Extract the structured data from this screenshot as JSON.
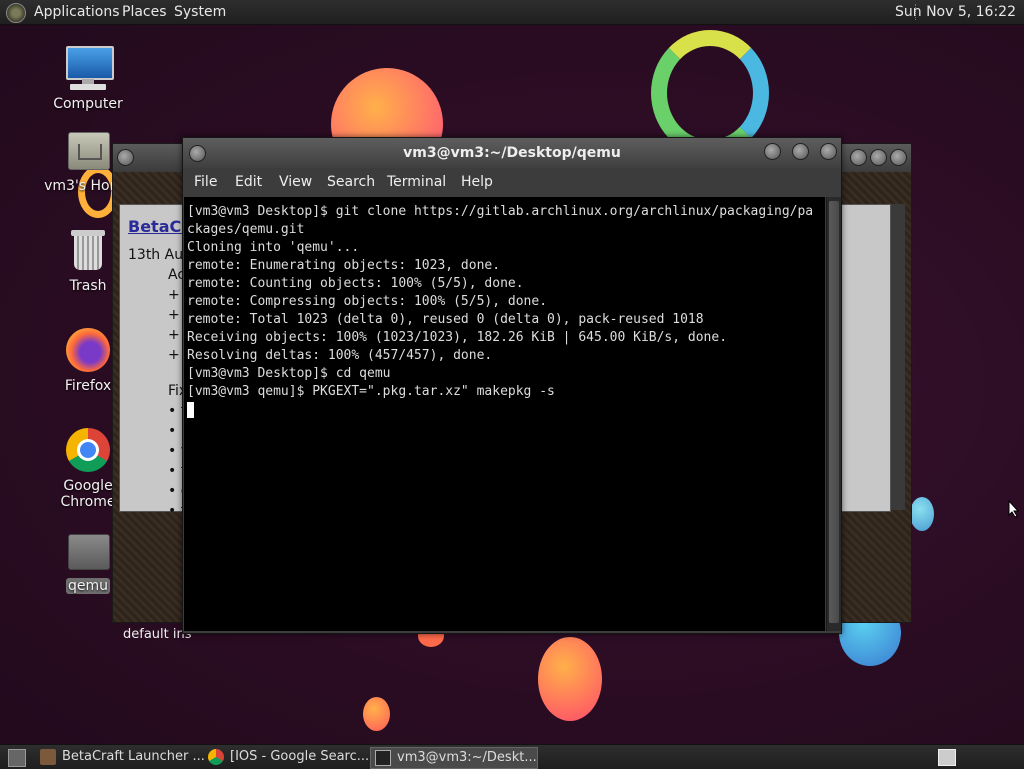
{
  "top_panel": {
    "menus": [
      "Applications",
      "Places",
      "System"
    ],
    "clock": "Sun Nov 5, 16:22"
  },
  "desktop_icons": [
    {
      "label": "Computer",
      "icon": "computer-icon"
    },
    {
      "label": "vm3's Home",
      "icon": "home-folder-icon"
    },
    {
      "label": "Trash",
      "icon": "trash-icon"
    },
    {
      "label": "Firefox",
      "icon": "firefox-icon"
    },
    {
      "label": "Google Chrome",
      "icon": "chrome-icon"
    },
    {
      "label": "qemu",
      "icon": "folder-icon",
      "selected": true
    }
  ],
  "background_window": {
    "link": "BetaCraft",
    "date": "13th Aug",
    "lines": [
      "Ac",
      "+ (",
      "+ (",
      "+ l",
      "+ l",
      "Fix",
      "• fi",
      "• D",
      "• v",
      "• th",
      "• c",
      "• fi"
    ],
    "footer": "default ins"
  },
  "terminal": {
    "title": "vm3@vm3:~/Desktop/qemu",
    "menu": [
      "File",
      "Edit",
      "View",
      "Search",
      "Terminal",
      "Help"
    ],
    "lines": [
      "[vm3@vm3 Desktop]$ git clone https://gitlab.archlinux.org/archlinux/packaging/pa",
      "ckages/qemu.git",
      "Cloning into 'qemu'...",
      "remote: Enumerating objects: 1023, done.",
      "remote: Counting objects: 100% (5/5), done.",
      "remote: Compressing objects: 100% (5/5), done.",
      "remote: Total 1023 (delta 0), reused 0 (delta 0), pack-reused 1018",
      "Receiving objects: 100% (1023/1023), 182.26 KiB | 645.00 KiB/s, done.",
      "Resolving deltas: 100% (457/457), done.",
      "[vm3@vm3 Desktop]$ cd qemu",
      "[vm3@vm3 qemu]$ PKGEXT=\".pkg.tar.xz\" makepkg -s"
    ]
  },
  "taskbar": {
    "tasks": [
      {
        "label": "BetaCraft Launcher ...",
        "icon": "java-icon"
      },
      {
        "label": "[IOS - Google Searc...",
        "icon": "chrome-icon"
      },
      {
        "label": "vm3@vm3:~/Deskt...",
        "icon": "terminal-icon",
        "active": true
      }
    ]
  },
  "colors": {
    "accent_wallpaper": "#2b0d24",
    "terminal_bg": "#000000",
    "terminal_fg": "#dddddd"
  }
}
